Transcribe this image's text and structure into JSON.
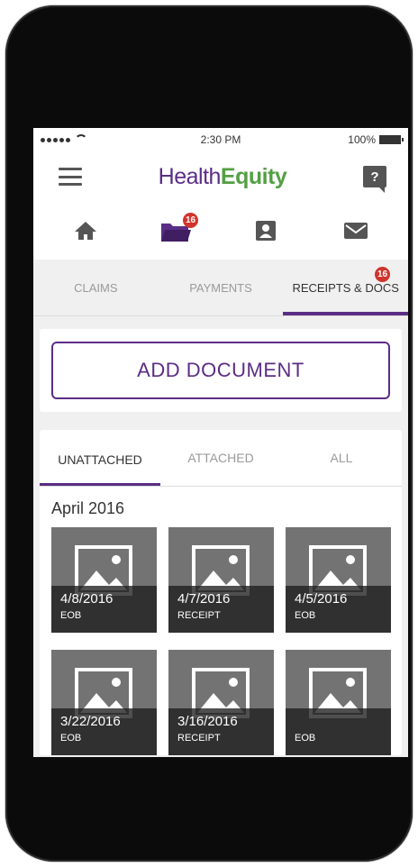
{
  "status_bar": {
    "time": "2:30 PM",
    "battery": "100%"
  },
  "header": {
    "logo_part1": "Health",
    "logo_part2": "Equity",
    "help_label": "?"
  },
  "icon_nav": {
    "folder_badge": "16"
  },
  "tabs": [
    {
      "label": "CLAIMS"
    },
    {
      "label": "PAYMENTS"
    },
    {
      "label": "RECEIPTS & DOCS",
      "badge": "16"
    }
  ],
  "add_document_label": "ADD DOCUMENT",
  "subtabs": [
    {
      "label": "UNATTACHED"
    },
    {
      "label": "ATTACHED"
    },
    {
      "label": "ALL"
    }
  ],
  "month_heading": "April 2016",
  "documents": [
    {
      "date": "4/8/2016",
      "type": "EOB"
    },
    {
      "date": "4/7/2016",
      "type": "RECEIPT"
    },
    {
      "date": "4/5/2016",
      "type": "EOB"
    },
    {
      "date": "3/22/2016",
      "type": "EOB"
    },
    {
      "date": "3/16/2016",
      "type": "RECEIPT"
    },
    {
      "date": "",
      "type": "EOB"
    }
  ],
  "colors": {
    "brand_purple": "#5b2d86",
    "brand_green": "#53a044",
    "badge_red": "#d0342c"
  }
}
